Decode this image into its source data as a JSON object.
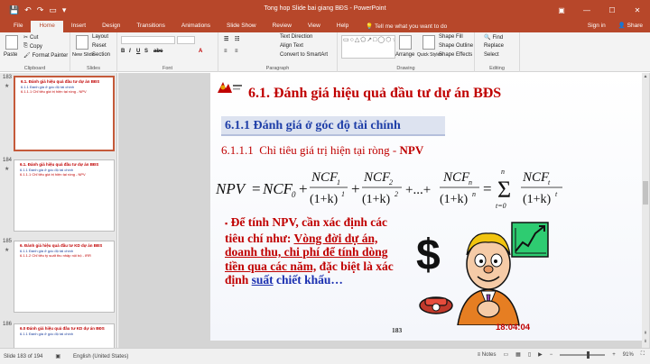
{
  "window": {
    "title": "Tong hop Slide bai giang BĐS - PowerPoint",
    "signin": "Sign in",
    "share": "Share"
  },
  "qat": [
    "save-icon",
    "undo-icon",
    "redo-icon",
    "start-icon"
  ],
  "tabs": [
    "File",
    "Home",
    "Insert",
    "Design",
    "Transitions",
    "Animations",
    "Slide Show",
    "Review",
    "View",
    "Help"
  ],
  "tell_me": "Tell me what you want to do",
  "ribbon": {
    "clipboard": {
      "paste": "Paste",
      "cut": "Cut",
      "copy": "Copy",
      "format_painter": "Format Painter",
      "label": "Clipboard"
    },
    "slides": {
      "new_slide": "New Slide",
      "layout": "Layout",
      "reset": "Reset",
      "section": "Section",
      "label": "Slides"
    },
    "font": {
      "label": "Font"
    },
    "paragraph": {
      "text_direction": "Text Direction",
      "align_text": "Align Text",
      "convert_smartart": "Convert to SmartArt",
      "label": "Paragraph"
    },
    "drawing": {
      "arrange": "Arrange",
      "quick_styles": "Quick Styles",
      "shape_fill": "Shape Fill",
      "shape_outline": "Shape Outline",
      "shape_effects": "Shape Effects",
      "label": "Drawing"
    },
    "editing": {
      "find": "Find",
      "replace": "Replace",
      "select": "Select",
      "label": "Editing"
    }
  },
  "thumbnails": [
    {
      "num": "183",
      "title": "6.1. Đánh giá hiệu quả đầu tư dự án BĐS",
      "line1": "6.1.1 Đánh giá ở góc độ tài chính",
      "line2": "6.1.1.1 Chỉ tiêu giá trị hiện tại ròng - NPV"
    },
    {
      "num": "184",
      "title": "6.1. Đánh giá hiệu quả đầu tư dự án BĐS",
      "line1": "6.1.1 Đánh giá ở góc độ tài chính",
      "line2": "6.1.1.1 Chỉ tiêu giá trị hiện tại ròng - NPV"
    },
    {
      "num": "185",
      "title": "6. Đánh giá hiệu quả đầu tư KD dự án BĐS",
      "line1": "6.1.1 Đánh giá ở góc độ tài chính",
      "line2": "6.1.1.2 Chỉ tiêu tỷ suất thu nhập nội bộ - IRR"
    },
    {
      "num": "186",
      "title": "6.0 Đánh giá hiệu quả đầu tư KD dự án BĐS",
      "line1": "6.1.1 Đánh giá ở góc độ tài chính",
      "line2": ""
    }
  ],
  "slide": {
    "title": "6.1. Đánh giá hiệu quả đầu tư dự án BĐS",
    "subtitle": "6.1.1 Đánh giá ở góc độ tài chính",
    "section_num": "6.1.1.1",
    "section_text": "Chỉ tiêu giá trị hiện tại ròng - ",
    "section_bold": "NPV",
    "bullet_marker": "▪",
    "bullet_red": "Để tính NPV, cần xác định các tiêu chí như: ",
    "bullet_underlined": "Vòng đời dự án, doanh thu, chi phí để tính dòng tiền qua các năm,",
    "bullet_tail_red": " đặc biệt là xác định ",
    "bullet_blue_u": "suất",
    "bullet_blue": " chiết khấu…",
    "page_number": "183",
    "clock": "18:04:04"
  },
  "formula": {
    "npv": "NPV",
    "equals": "=",
    "ncf0": "NCF",
    "sub0": "0",
    "ncf1": "NCF",
    "sub1": "1",
    "den1": "(1+k)",
    "exp1": "1",
    "ncf2": "NCF",
    "sub2": "2",
    "den2": "(1+k)",
    "exp2": "2",
    "dots": "+...+",
    "ncfn": "NCF",
    "subn": "n",
    "denn": "(1+k)",
    "expn": "n",
    "sum_top": "n",
    "sum_bot": "t=0",
    "ncft": "NCF",
    "subt": "t",
    "dent": "(1+k)",
    "expt": "t"
  },
  "status": {
    "slide": "Slide 183 of 194",
    "language": "English (United States)",
    "notes": "Notes",
    "zoom": "91%"
  },
  "colors": {
    "accent": "#b7472a",
    "slide_title": "#c00000",
    "slide_blue": "#1f3fa8"
  }
}
